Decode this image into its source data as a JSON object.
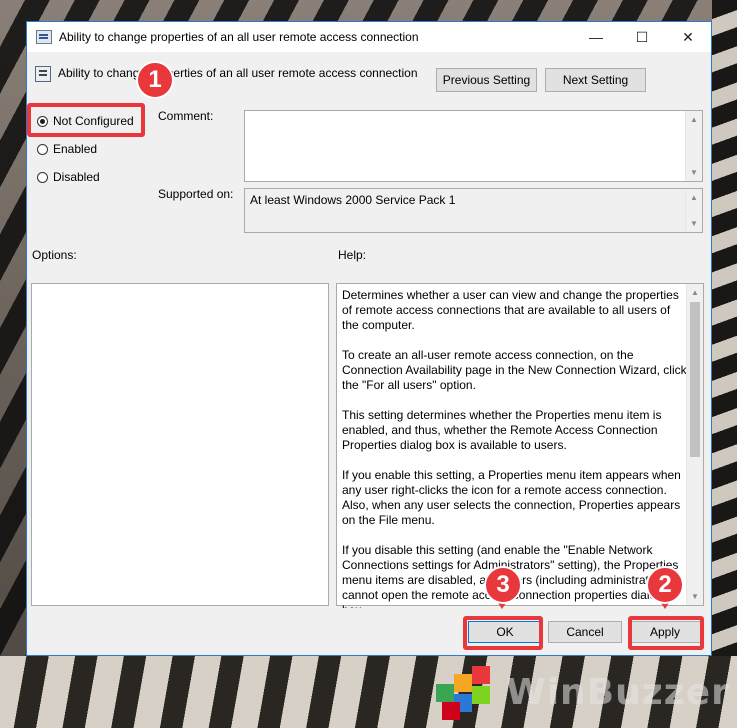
{
  "window": {
    "title": "Ability to change properties of an all user remote access connection",
    "minimize_glyph": "—",
    "maximize_glyph": "☐",
    "close_glyph": "✕"
  },
  "setting": {
    "name": "Ability to change properties of an all user remote access connection"
  },
  "nav": {
    "previous": "Previous Setting",
    "next": "Next Setting"
  },
  "state": {
    "options": [
      "Not Configured",
      "Enabled",
      "Disabled"
    ],
    "selected": "Not Configured"
  },
  "comment": {
    "label": "Comment:",
    "value": ""
  },
  "supported": {
    "label": "Supported on:",
    "value": "At least Windows 2000 Service Pack 1"
  },
  "options_label": "Options:",
  "help_label": "Help:",
  "help_paragraphs": [
    "Determines whether a user can view and change the properties of remote access connections that are available to all users of the computer.",
    "To create an all-user remote access connection, on the Connection Availability page in the New Connection Wizard, click the \"For all users\" option.",
    "This setting determines whether the Properties menu item is enabled, and thus, whether the Remote Access Connection Properties dialog box is available to users.",
    "If you enable this setting, a Properties menu item appears when any user right-clicks the icon for a remote access connection. Also, when any user selects the connection, Properties appears on the File menu.",
    "If you disable this setting (and enable the \"Enable Network Connections settings for Administrators\" setting), the Properties menu items are disabled, and users (including administrators) cannot open the remote access connection properties dialog box."
  ],
  "buttons": {
    "ok": "OK",
    "cancel": "Cancel",
    "apply": "Apply"
  },
  "callouts": {
    "one": "1",
    "two": "2",
    "three": "3"
  },
  "watermark": {
    "text": "WinBuzzer"
  },
  "colors": {
    "accent": "#0078d7",
    "callout": "#e8383b",
    "border": "#2b79d6"
  },
  "icons": {
    "app": "group-policy-icon",
    "setting": "policy-setting-icon",
    "logo": "winbuzzer-cubes-logo"
  }
}
